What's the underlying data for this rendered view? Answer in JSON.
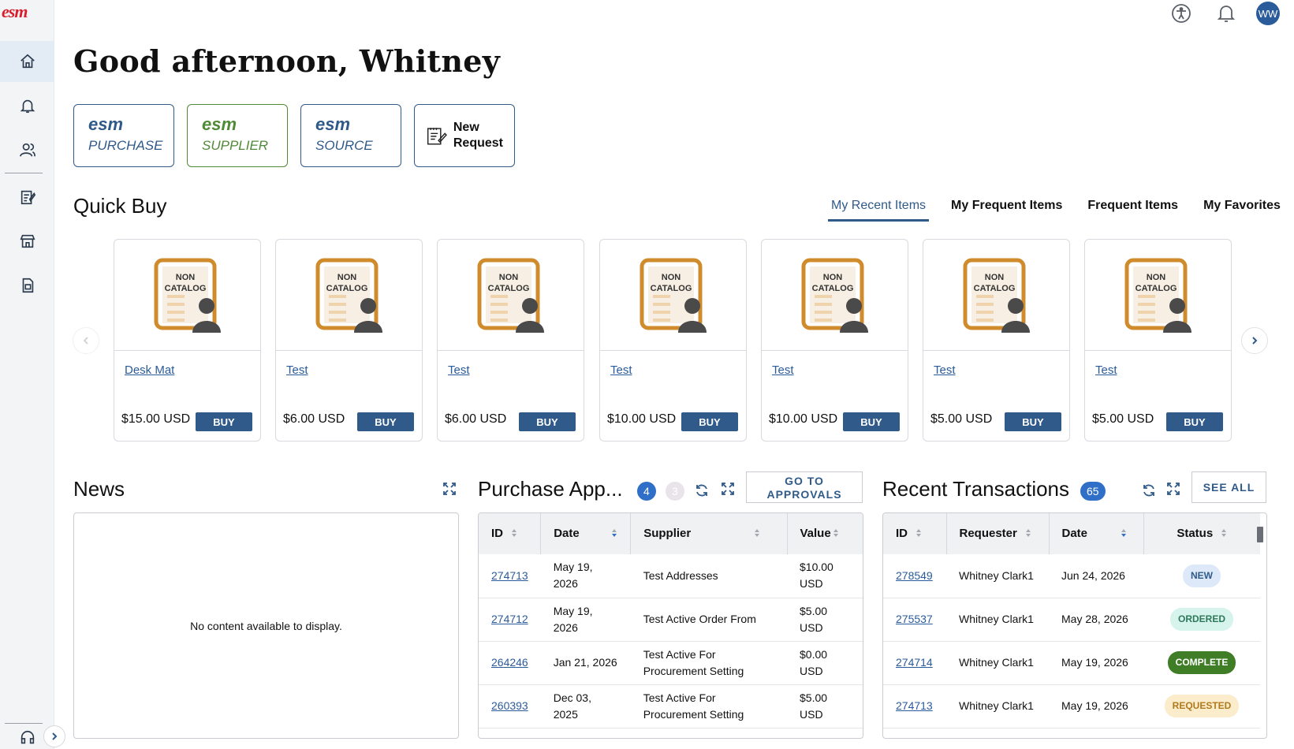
{
  "app": {
    "logo": "esm",
    "user_initials": "WW"
  },
  "greeting": "Good afternoon, Whitney",
  "shortcuts": [
    {
      "brand": "esm",
      "sub": "PURCHASE"
    },
    {
      "brand": "esm",
      "sub": "SUPPLIER"
    },
    {
      "brand": "esm",
      "sub": "SOURCE"
    }
  ],
  "new_request": {
    "line1": "New",
    "line2": "Request"
  },
  "quick_buy": {
    "title": "Quick Buy",
    "tabs": [
      "My Recent Items",
      "My Frequent Items",
      "Frequent Items",
      "My Favorites"
    ],
    "image_caption": [
      "NON",
      "CATALOG"
    ],
    "buy_label": "BUY",
    "items": [
      {
        "name": "Desk Mat",
        "price": "$15.00 USD"
      },
      {
        "name": "Test",
        "price": "$6.00 USD"
      },
      {
        "name": "Test",
        "price": "$6.00 USD"
      },
      {
        "name": "Test",
        "price": "$10.00 USD"
      },
      {
        "name": "Test",
        "price": "$10.00 USD"
      },
      {
        "name": "Test",
        "price": "$5.00 USD"
      },
      {
        "name": "Test",
        "price": "$5.00 USD"
      }
    ]
  },
  "news": {
    "title": "News",
    "empty": "No content available to display."
  },
  "approvals": {
    "title": "Purchase App...",
    "badge_pending": "4",
    "badge_other": "3",
    "go_line1": "GO TO",
    "go_line2": "APPROVALS",
    "columns": [
      "ID",
      "Date",
      "Supplier",
      "Value"
    ],
    "rows": [
      {
        "id": "274713",
        "date": [
          "May 19,",
          "2026"
        ],
        "supplier": [
          "Test Addresses"
        ],
        "value": [
          "$10.00",
          "USD"
        ]
      },
      {
        "id": "274712",
        "date": [
          "May 19,",
          "2026"
        ],
        "supplier": [
          "Test Active Order From"
        ],
        "value": [
          "$5.00",
          "USD"
        ]
      },
      {
        "id": "264246",
        "date": [
          "Jan 21, 2026"
        ],
        "supplier": [
          "Test Active For",
          "Procurement Setting"
        ],
        "value": [
          "$0.00",
          "USD"
        ]
      },
      {
        "id": "260393",
        "date": [
          "Dec 03, 2025"
        ],
        "supplier": [
          "Test Active For",
          "Procurement Setting"
        ],
        "value": [
          "$5.00",
          "USD"
        ]
      }
    ]
  },
  "transactions": {
    "title": "Recent Transactions",
    "count": "65",
    "see_all": "SEE ALL",
    "columns": [
      "ID",
      "Requester",
      "Date",
      "Status"
    ],
    "rows": [
      {
        "id": "278549",
        "requester": "Whitney Clark1",
        "date": "Jun 24, 2026",
        "status": "NEW"
      },
      {
        "id": "275537",
        "requester": "Whitney Clark1",
        "date": "May 28, 2026",
        "status": "ORDERED"
      },
      {
        "id": "274714",
        "requester": "Whitney Clark1",
        "date": "May 19, 2026",
        "status": "COMPLETE"
      },
      {
        "id": "274713",
        "requester": "Whitney Clark1",
        "date": "May 19, 2026",
        "status": "REQUESTED"
      }
    ]
  },
  "colors": {
    "brand_red": "#d81e2c",
    "primary": "#2f5a8a",
    "green": "#4f8a36"
  }
}
